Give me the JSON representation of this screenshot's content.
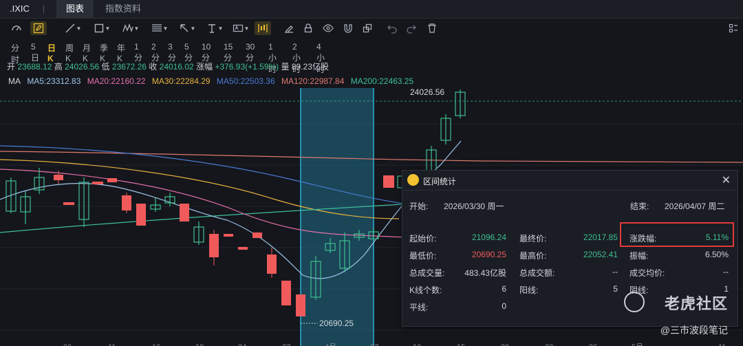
{
  "header": {
    "symbol": ".IXIC",
    "separator": "|",
    "tabs": [
      {
        "label": "图表"
      },
      {
        "label": "指数资料"
      }
    ]
  },
  "periods": [
    "分时",
    "5日",
    "日K",
    "周K",
    "月K",
    "季K",
    "年K",
    "1分",
    "2分",
    "3分",
    "5分",
    "10分",
    "15分",
    "30分",
    "1小时",
    "2小时",
    "4小时"
  ],
  "active_period": "日K",
  "ohlc": {
    "open_label": "开",
    "open": "23688.12",
    "high_label": "高",
    "high": "24026.56",
    "low_label": "低",
    "low": "23672.26",
    "close_label": "收",
    "close": "24016.02",
    "chg_label": "涨幅",
    "chg": "+376.93(+1.59%)",
    "vol_label": "量",
    "vol": "89.23亿股"
  },
  "ma_legend": [
    {
      "text": "MA",
      "color": "#d5d7dc"
    },
    {
      "text": "MA5:23312.83",
      "color": "#9fc6e8"
    },
    {
      "text": "MA20:22160.22",
      "color": "#e36ea7"
    },
    {
      "text": "MA30:22284.29",
      "color": "#e8b23e"
    },
    {
      "text": "MA50:22503.36",
      "color": "#4a7bd1"
    },
    {
      "text": "MA120:22987.84",
      "color": "#e07a6e"
    },
    {
      "text": "MA200:22463.25",
      "color": "#3fbf9f"
    }
  ],
  "chart_labels": {
    "high_mark": "24026.56",
    "low_mark": "20690.25"
  },
  "x_ticks": [
    "06",
    "11",
    "16",
    "19",
    "24",
    "27",
    "4月",
    "07",
    "10",
    "15",
    "20",
    "23",
    "26",
    "5月",
    "11"
  ],
  "stats": {
    "title": "区间统计",
    "start_label": "开始:",
    "start": "2026/03/30 周一",
    "end_label": "结束:",
    "end": "2026/04/07 周二",
    "rows": [
      {
        "l1": "起始价:",
        "v1": "21096.24",
        "c1": "up",
        "l2": "最终价:",
        "v2": "22017.85",
        "c2": "up",
        "l3": "涨跌幅:",
        "v3": "5.11%",
        "c3": "up"
      },
      {
        "l1": "最低价:",
        "v1": "20690.25",
        "c1": "dn",
        "l2": "最高价:",
        "v2": "22052.41",
        "c2": "up",
        "l3": "振幅:",
        "v3": "6.50%",
        "c3": "n"
      },
      {
        "l1": "总成交量:",
        "v1": "483.43亿股",
        "c1": "n",
        "l2": "总成交额:",
        "v2": "--",
        "c2": "n",
        "l3": "成交均价:",
        "v3": "--",
        "c3": "n"
      },
      {
        "l1": "K线个数:",
        "v1": "6",
        "c1": "n",
        "l2": "阳线:",
        "v2": "5",
        "c2": "n",
        "l3": "阴线:",
        "v3": "1",
        "c3": "n"
      },
      {
        "l1": "平线:",
        "v1": "0",
        "c1": "n",
        "l2": "",
        "v2": "",
        "c2": "n",
        "l3": "",
        "v3": "",
        "c3": "n"
      }
    ]
  },
  "watermark": {
    "brand": "老虎社区",
    "author": "@三市波段笔记"
  },
  "colors": {
    "up": "#3fbf8f",
    "down": "#f05a5a",
    "accent": "#f2c230",
    "selection": "#1f6f8b"
  }
}
